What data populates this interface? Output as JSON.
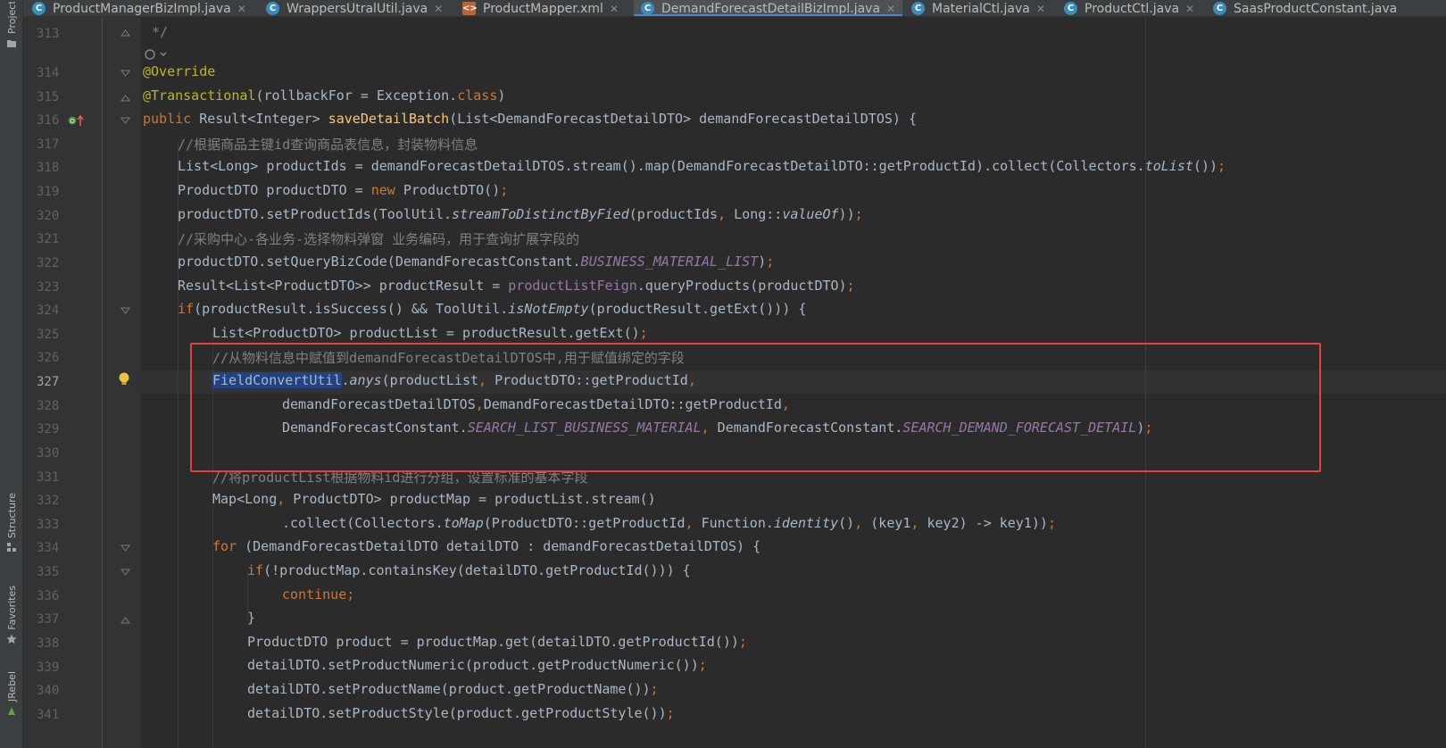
{
  "tabs": [
    {
      "label": "ProductManagerBizImpl.java",
      "icon": "java-class-icon",
      "active": false
    },
    {
      "label": "WrappersUtralUtil.java",
      "icon": "java-class-icon",
      "active": false
    },
    {
      "label": "ProductMapper.xml",
      "icon": "xml-file-icon",
      "active": false
    },
    {
      "label": "DemandForecastDetailBizImpl.java",
      "icon": "java-class-icon",
      "active": true
    },
    {
      "label": "MaterialCtl.java",
      "icon": "java-class-icon",
      "active": false
    },
    {
      "label": "ProductCtl.java",
      "icon": "java-class-icon",
      "active": false
    },
    {
      "label": "SaasProductConstant.java",
      "icon": "java-class-icon",
      "active": false
    }
  ],
  "tool_strip": {
    "project": "Project",
    "structure": "Structure",
    "favorites": "Favorites",
    "jrebel": "JRebel"
  },
  "gutter": {
    "line_numbers": [
      "313",
      "314",
      "315",
      "316",
      "317",
      "318",
      "319",
      "320",
      "321",
      "322",
      "323",
      "324",
      "325",
      "326",
      "327",
      "328",
      "329",
      "330",
      "331",
      "332",
      "333",
      "334",
      "335",
      "336",
      "337",
      "338",
      "339",
      "340",
      "341"
    ],
    "current_line": "327"
  },
  "code": {
    "doc_comment_end": "*/",
    "l314": "@Override",
    "l315_anno": "@Transactional",
    "l315_rest": "(rollbackFor = Exception.",
    "l315_class": "class",
    "l315_end": ")",
    "l316_public": "public",
    "l316_type": " Result<Integer> ",
    "l316_method": "saveDetailBatch",
    "l316_rest": "(List<DemandForecastDetailDTO> demandForecastDetailDTOS) {",
    "l317": "//根据商品主键id查询商品表信息，封装物料信息",
    "l318_a": "List<Long> productIds = demandForecastDetailDTOS.stream().map(DemandForecastDetailDTO::getProductId).collect(Collectors.",
    "l318_b": "toList",
    "l318_c": "())",
    "l318_d": ";",
    "l319_a": "ProductDTO productDTO = ",
    "l319_new": "new",
    "l319_b": " ProductDTO()",
    "l319_c": ";",
    "l320_a": "productDTO.setProductIds(ToolUtil.",
    "l320_b": "streamToDistinctByFied",
    "l320_c": "(productIds",
    "l320_d": ",",
    "l320_e": " Long::",
    "l320_f": "valueOf",
    "l320_g": "))",
    "l320_h": ";",
    "l321": "//采购中心-各业务-选择物料弹窗 业务编码，用于查询扩展字段的",
    "l322_a": "productDTO.setQueryBizCode(DemandForecastConstant.",
    "l322_b": "BUSINESS_MATERIAL_LIST",
    "l322_c": ")",
    "l322_d": ";",
    "l323_a": "Result<List<ProductDTO>> productResult = ",
    "l323_b": "productListFeign",
    "l323_c": ".queryProducts(productDTO)",
    "l323_d": ";",
    "l324_if": "if",
    "l324_a": "(productResult.isSuccess() && ToolUtil.",
    "l324_b": "isNotEmpty",
    "l324_c": "(productResult.getExt())) {",
    "l325_a": "List<ProductDTO> productList = productResult.getExt()",
    "l325_b": ";",
    "l326": "//从物料信息中赋值到demandForecastDetailDTOS中,用于赋值绑定的字段",
    "l327_sel": "FieldConvertUtil",
    "l327_a": ".",
    "l327_b": "anys",
    "l327_c": "(productList",
    "l327_d": ",",
    "l327_e": " ProductDTO::getProductId",
    "l327_f": ",",
    "l328_a": "demandForecastDetailDTOS",
    "l328_b": ",",
    "l328_c": "DemandForecastDetailDTO::getProductId",
    "l328_d": ",",
    "l329_a": "DemandForecastConstant.",
    "l329_b": "SEARCH_LIST_BUSINESS_MATERIAL",
    "l329_c": ",",
    "l329_d": " DemandForecastConstant.",
    "l329_e": "SEARCH_DEMAND_FORECAST_DETAIL",
    "l329_f": ")",
    "l329_g": ";",
    "l331": "//将productList根据物料id进行分组，设置标准的基本字段",
    "l332_a": "Map<Long",
    "l332_b": ",",
    "l332_c": " ProductDTO> productMap = productList.stream()",
    "l333_a": ".collect(Collectors.",
    "l333_b": "toMap",
    "l333_c": "(ProductDTO::getProductId",
    "l333_d": ",",
    "l333_e": " Function.",
    "l333_f": "identity",
    "l333_g": "()",
    "l333_h": ",",
    "l333_i": " (key1",
    "l333_j": ",",
    "l333_k": " key2) -> key1))",
    "l333_l": ";",
    "l334_for": "for",
    "l334_a": " (DemandForecastDetailDTO detailDTO : demandForecastDetailDTOS) {",
    "l335_if": "if",
    "l335_a": "(!productMap.containsKey(detailDTO.getProductId())) {",
    "l336": "continue",
    "l336_b": ";",
    "l337": "}",
    "l338_a": "ProductDTO product = productMap.get(detailDTO.getProductId())",
    "l338_b": ";",
    "l339_a": "detailDTO.setProductNumeric(product.getProductNumeric())",
    "l339_b": ";",
    "l340_a": "detailDTO.setProductName(product.getProductName())",
    "l340_b": ";",
    "l341_a": "detailDTO.setProductStyle(product.getProductStyle())",
    "l341_b": ";"
  },
  "colors": {
    "background": "#2b2b2b",
    "keyword": "#cc7832",
    "annotation": "#bbb529",
    "method_decl": "#ffc66d",
    "comment": "#808080",
    "static_field": "#9876aa",
    "highlight_box": "#e3403e",
    "selection": "#214283"
  }
}
